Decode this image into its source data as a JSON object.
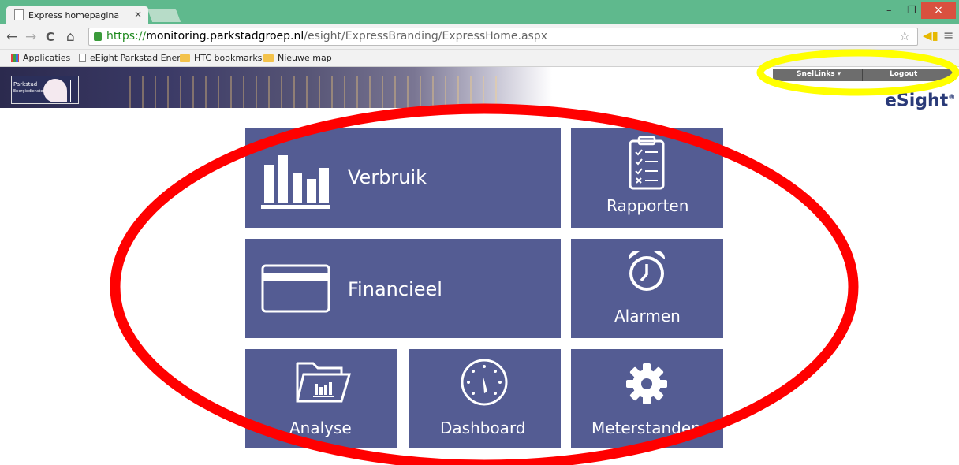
{
  "browser": {
    "tab_title": "Express homepagina",
    "tab_close": "×",
    "url_scheme": "https://",
    "url_host": "monitoring.parkstadgroep.nl",
    "url_path": "/esight/ExpressBranding/ExpressHome.aspx",
    "minimize": "–",
    "restore": "❐",
    "close": "×",
    "back": "←",
    "forward": "→",
    "reload": "C",
    "home": "⌂",
    "star": "☆",
    "menu": "≡"
  },
  "bookmarks": [
    {
      "label": "Applicaties",
      "icon": "apps-icon"
    },
    {
      "label": "eEight Parkstad Ener...",
      "icon": "page-icon"
    },
    {
      "label": "HTC bookmarks",
      "icon": "folder-icon"
    },
    {
      "label": "Nieuwe map",
      "icon": "folder-icon"
    }
  ],
  "header": {
    "logo_text": "Parkstad",
    "logo_subtext": "Energiediensten",
    "snellinks": "SnelLinks",
    "snellinks_caret": "▾",
    "logout": "Logout",
    "brand": "eSight",
    "brand_mark": "®"
  },
  "tiles": {
    "verbruik": "Verbruik",
    "rapporten": "Rapporten",
    "financieel": "Financieel",
    "alarmen": "Alarmen",
    "analyse": "Analyse",
    "dashboard": "Dashboard",
    "meterstanden": "Meterstanden"
  },
  "colors": {
    "tile": "#545c93",
    "chrome_frame": "#5fb98d",
    "red_annotation": "#ff0000",
    "yellow_annotation": "#ffff00"
  }
}
